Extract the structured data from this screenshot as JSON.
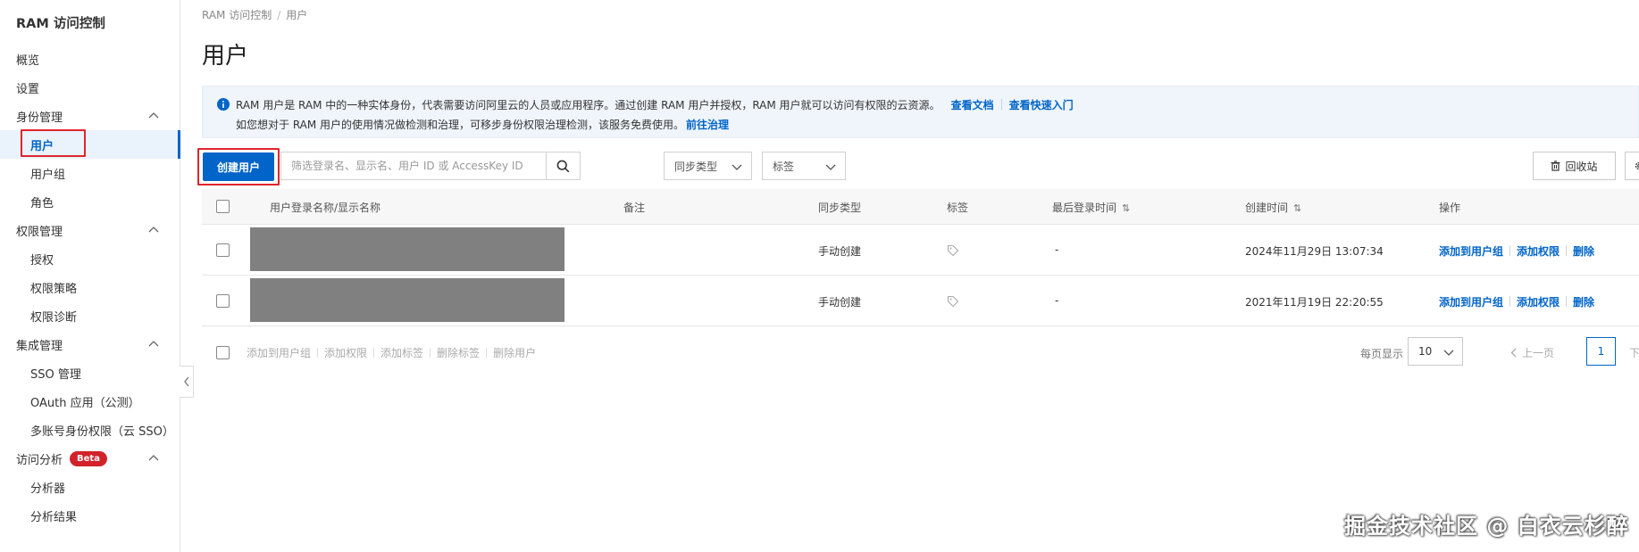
{
  "sidebar": {
    "title": "RAM 访问控制",
    "items": [
      {
        "label": "概览"
      },
      {
        "label": "设置"
      },
      {
        "label": "身份管理"
      },
      {
        "label": "用户"
      },
      {
        "label": "用户组"
      },
      {
        "label": "角色"
      },
      {
        "label": "权限管理"
      },
      {
        "label": "授权"
      },
      {
        "label": "权限策略"
      },
      {
        "label": "权限诊断"
      },
      {
        "label": "集成管理"
      },
      {
        "label": "SSO 管理"
      },
      {
        "label": "OAuth 应用（公测）"
      },
      {
        "label": "多账号身份权限（云 SSO）"
      },
      {
        "label": "访问分析"
      },
      {
        "label": "分析器"
      },
      {
        "label": "分析结果"
      }
    ],
    "beta_badge": "Beta"
  },
  "breadcrumb": {
    "root": "RAM 访问控制",
    "sep": "/",
    "current": "用户"
  },
  "page_title": "用户",
  "info": {
    "line1": "RAM 用户是 RAM 中的一种实体身份，代表需要访问阿里云的人员或应用程序。通过创建 RAM 用户并授权，RAM 用户就可以访问有权限的云资源。",
    "link_docs": "查看文档",
    "link_quickstart": "查看快速入门",
    "line2": "如您想对于 RAM 用户的使用情况做检测和治理，可移步身份权限治理检测，该服务免费使用。",
    "link_governance": "前往治理"
  },
  "toolbar": {
    "create_user": "创建用户",
    "search_placeholder": "筛选登录名、显示名、用户 ID 或 AccessKey ID",
    "sync_type": "同步类型",
    "tags": "标签",
    "recycle_bin": "回收站"
  },
  "table": {
    "headers": {
      "name": "用户登录名称/显示名称",
      "note": "备注",
      "sync": "同步类型",
      "tag": "标签",
      "last_login": "最后登录时间",
      "created": "创建时间",
      "ops": "操作"
    },
    "rows": [
      {
        "sync": "手动创建",
        "last_login": "-",
        "created": "2024年11月29日 13:07:34"
      },
      {
        "sync": "手动创建",
        "last_login": "-",
        "created": "2021年11月19日 22:20:55"
      }
    ],
    "actions": {
      "add_group": "添加到用户组",
      "add_perm": "添加权限",
      "delete": "删除"
    }
  },
  "footer": {
    "bulk": [
      "添加到用户组",
      "添加权限",
      "添加标签",
      "删除标签",
      "删除用户"
    ],
    "page_size_label": "每页显示",
    "page_size": "10",
    "prev": "上一页",
    "current_page": "1",
    "next": "下一"
  },
  "watermark": "掘金技术社区 @ 白衣云杉醉",
  "colors": {
    "primary": "#0064c8",
    "highlight": "#e0252c",
    "info_bg": "#eff5fb",
    "redacted": "#808080"
  }
}
